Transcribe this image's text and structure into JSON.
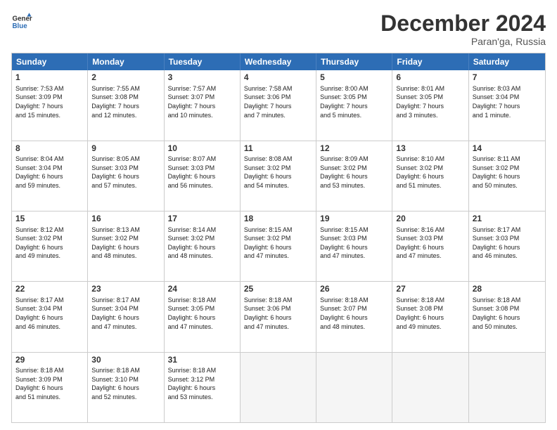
{
  "header": {
    "logo_line1": "General",
    "logo_line2": "Blue",
    "month": "December 2024",
    "location": "Paran'ga, Russia"
  },
  "weekdays": [
    "Sunday",
    "Monday",
    "Tuesday",
    "Wednesday",
    "Thursday",
    "Friday",
    "Saturday"
  ],
  "rows": [
    [
      {
        "day": "1",
        "text": "Sunrise: 7:53 AM\nSunset: 3:09 PM\nDaylight: 7 hours\nand 15 minutes."
      },
      {
        "day": "2",
        "text": "Sunrise: 7:55 AM\nSunset: 3:08 PM\nDaylight: 7 hours\nand 12 minutes."
      },
      {
        "day": "3",
        "text": "Sunrise: 7:57 AM\nSunset: 3:07 PM\nDaylight: 7 hours\nand 10 minutes."
      },
      {
        "day": "4",
        "text": "Sunrise: 7:58 AM\nSunset: 3:06 PM\nDaylight: 7 hours\nand 7 minutes."
      },
      {
        "day": "5",
        "text": "Sunrise: 8:00 AM\nSunset: 3:05 PM\nDaylight: 7 hours\nand 5 minutes."
      },
      {
        "day": "6",
        "text": "Sunrise: 8:01 AM\nSunset: 3:05 PM\nDaylight: 7 hours\nand 3 minutes."
      },
      {
        "day": "7",
        "text": "Sunrise: 8:03 AM\nSunset: 3:04 PM\nDaylight: 7 hours\nand 1 minute."
      }
    ],
    [
      {
        "day": "8",
        "text": "Sunrise: 8:04 AM\nSunset: 3:04 PM\nDaylight: 6 hours\nand 59 minutes."
      },
      {
        "day": "9",
        "text": "Sunrise: 8:05 AM\nSunset: 3:03 PM\nDaylight: 6 hours\nand 57 minutes."
      },
      {
        "day": "10",
        "text": "Sunrise: 8:07 AM\nSunset: 3:03 PM\nDaylight: 6 hours\nand 56 minutes."
      },
      {
        "day": "11",
        "text": "Sunrise: 8:08 AM\nSunset: 3:02 PM\nDaylight: 6 hours\nand 54 minutes."
      },
      {
        "day": "12",
        "text": "Sunrise: 8:09 AM\nSunset: 3:02 PM\nDaylight: 6 hours\nand 53 minutes."
      },
      {
        "day": "13",
        "text": "Sunrise: 8:10 AM\nSunset: 3:02 PM\nDaylight: 6 hours\nand 51 minutes."
      },
      {
        "day": "14",
        "text": "Sunrise: 8:11 AM\nSunset: 3:02 PM\nDaylight: 6 hours\nand 50 minutes."
      }
    ],
    [
      {
        "day": "15",
        "text": "Sunrise: 8:12 AM\nSunset: 3:02 PM\nDaylight: 6 hours\nand 49 minutes."
      },
      {
        "day": "16",
        "text": "Sunrise: 8:13 AM\nSunset: 3:02 PM\nDaylight: 6 hours\nand 48 minutes."
      },
      {
        "day": "17",
        "text": "Sunrise: 8:14 AM\nSunset: 3:02 PM\nDaylight: 6 hours\nand 48 minutes."
      },
      {
        "day": "18",
        "text": "Sunrise: 8:15 AM\nSunset: 3:02 PM\nDaylight: 6 hours\nand 47 minutes."
      },
      {
        "day": "19",
        "text": "Sunrise: 8:15 AM\nSunset: 3:03 PM\nDaylight: 6 hours\nand 47 minutes."
      },
      {
        "day": "20",
        "text": "Sunrise: 8:16 AM\nSunset: 3:03 PM\nDaylight: 6 hours\nand 47 minutes."
      },
      {
        "day": "21",
        "text": "Sunrise: 8:17 AM\nSunset: 3:03 PM\nDaylight: 6 hours\nand 46 minutes."
      }
    ],
    [
      {
        "day": "22",
        "text": "Sunrise: 8:17 AM\nSunset: 3:04 PM\nDaylight: 6 hours\nand 46 minutes."
      },
      {
        "day": "23",
        "text": "Sunrise: 8:17 AM\nSunset: 3:04 PM\nDaylight: 6 hours\nand 47 minutes."
      },
      {
        "day": "24",
        "text": "Sunrise: 8:18 AM\nSunset: 3:05 PM\nDaylight: 6 hours\nand 47 minutes."
      },
      {
        "day": "25",
        "text": "Sunrise: 8:18 AM\nSunset: 3:06 PM\nDaylight: 6 hours\nand 47 minutes."
      },
      {
        "day": "26",
        "text": "Sunrise: 8:18 AM\nSunset: 3:07 PM\nDaylight: 6 hours\nand 48 minutes."
      },
      {
        "day": "27",
        "text": "Sunrise: 8:18 AM\nSunset: 3:08 PM\nDaylight: 6 hours\nand 49 minutes."
      },
      {
        "day": "28",
        "text": "Sunrise: 8:18 AM\nSunset: 3:08 PM\nDaylight: 6 hours\nand 50 minutes."
      }
    ],
    [
      {
        "day": "29",
        "text": "Sunrise: 8:18 AM\nSunset: 3:09 PM\nDaylight: 6 hours\nand 51 minutes."
      },
      {
        "day": "30",
        "text": "Sunrise: 8:18 AM\nSunset: 3:10 PM\nDaylight: 6 hours\nand 52 minutes."
      },
      {
        "day": "31",
        "text": "Sunrise: 8:18 AM\nSunset: 3:12 PM\nDaylight: 6 hours\nand 53 minutes."
      },
      null,
      null,
      null,
      null
    ]
  ]
}
